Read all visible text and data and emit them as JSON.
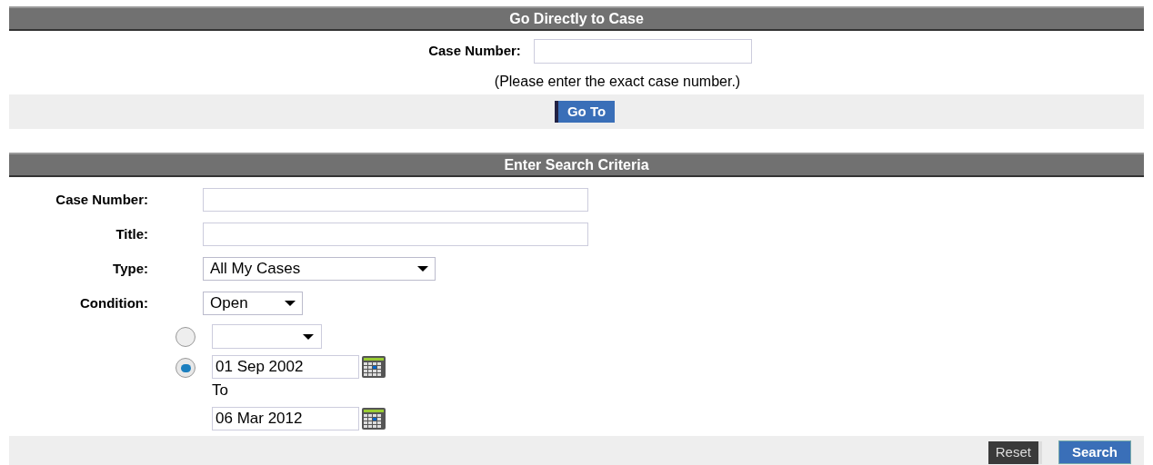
{
  "go_to_case": {
    "title": "Go Directly to Case",
    "label": "Case Number:",
    "hint": "(Please enter the exact case number.)",
    "button": "Go To"
  },
  "search": {
    "title": "Enter Search Criteria",
    "fields": [
      {
        "kind": "text",
        "label": "Case Number:"
      },
      {
        "kind": "text",
        "label": "Title:"
      },
      {
        "kind": "select",
        "label": "Type:",
        "value": "All My Cases"
      },
      {
        "kind": "select",
        "label": "Condition:",
        "value": "Open"
      }
    ],
    "date_options": [
      {
        "kind": "select",
        "selected": false
      },
      {
        "kind": "range",
        "selected": true,
        "from": "01 Sep 2002",
        "to_label": "To",
        "to": "06 Mar 2012"
      }
    ],
    "buttons": [
      {
        "kind": "reset",
        "label": "Reset"
      },
      {
        "kind": "primary",
        "label": "Search"
      }
    ]
  }
}
